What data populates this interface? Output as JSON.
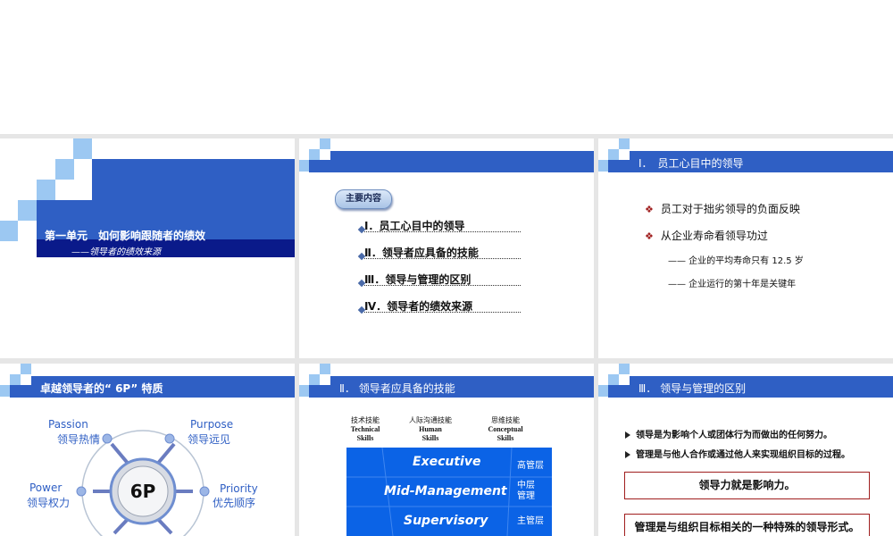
{
  "slide1": {
    "title": "第一单元　如何影响跟随者的绩效",
    "subtitle": "——领导者的绩效来源"
  },
  "slide2": {
    "badge": "主要内容",
    "items": [
      "Ⅰ．员工心目中的领导",
      "Ⅱ．领导者应具备的技能",
      "Ⅲ．领导与管理的区别",
      "Ⅳ．领导者的绩效来源"
    ]
  },
  "slide3": {
    "header": "Ⅰ．　员工心目中的领导",
    "bullets": [
      "员工对于拙劣领导的负面反映",
      "从企业寿命看领导功过"
    ],
    "subitems": [
      "—— 企业的平均寿命只有 12.5 岁",
      "—— 企业运行的第十年是关键年"
    ]
  },
  "slide4": {
    "header": "卓越领导者的“ 6P” 特质",
    "center": "6P",
    "labels": {
      "passion_en": "Passion",
      "passion_cn": "领导热情",
      "purpose_en": "Purpose",
      "purpose_cn": "领导远见",
      "power_en": "Power",
      "power_cn": "领导权力",
      "priority_en": "Priority",
      "priority_cn": "优先顺序"
    }
  },
  "slide5": {
    "header": "Ⅱ．  领导者应具备的技能",
    "columns": [
      {
        "cn": "技术技能",
        "en1": "Technical",
        "en2": "Skills"
      },
      {
        "cn": "人际沟通技能",
        "en1": "Human",
        "en2": "Skills"
      },
      {
        "cn": "思维技能",
        "en1": "Conceptual",
        "en2": "Skills"
      }
    ],
    "levels": [
      {
        "en": "Executive",
        "cn": "高管层"
      },
      {
        "en": "Mid-Management",
        "cn": "中层管理"
      },
      {
        "en": "Supervisory",
        "cn": "主管层"
      }
    ]
  },
  "slide6": {
    "header": "Ⅲ．  领导与管理的区别",
    "bullets": [
      "领导是为影响个人或团体行为而做出的任何努力。",
      "管理是与他人合作或通过他人来实现组织目标的过程。"
    ],
    "box1": "领导力就是影响力。",
    "box2": "管理是与组织目标相关的一种特殊的领导形式。"
  },
  "colors": {
    "accent": "#2f5fc4",
    "navy": "#0a1a8a",
    "light_blue": "#8fc0ef",
    "box_red": "#a01e1e"
  }
}
